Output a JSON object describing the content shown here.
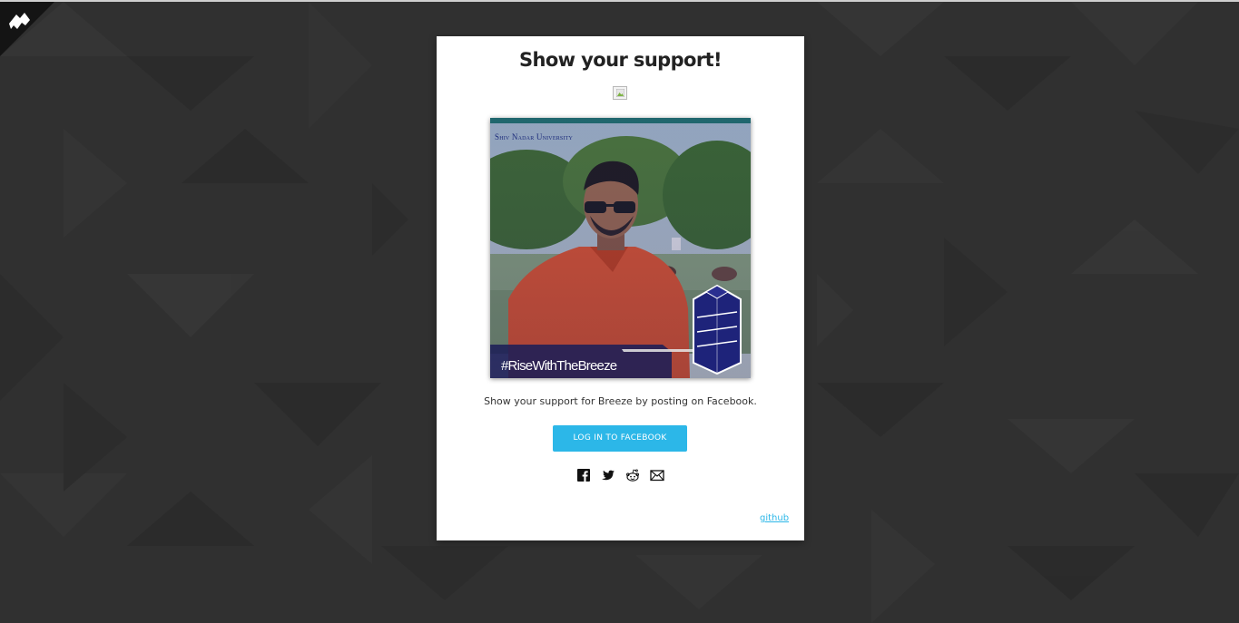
{
  "page": {
    "background_color": "#2f2f2f",
    "corner_logo_icon": "breeze-logo-icon"
  },
  "card": {
    "title": "Show your support!",
    "broken_image_icon": "broken-image-icon",
    "photo": {
      "watermark": "Shiv Nadar University",
      "hashtag": "#RiseWithTheBreeze",
      "overlay_icon": "breeze-tower-icon"
    },
    "description": "Show your support for Breeze by posting on Facebook.",
    "facebook_button_label": "LOG IN TO FACEBOOK",
    "share_icons": [
      "facebook-icon",
      "twitter-icon",
      "reddit-icon",
      "email-icon"
    ],
    "github_link": "github"
  },
  "colors": {
    "accent": "#2cb7e8",
    "title": "#222222",
    "card_bg": "#ffffff"
  }
}
